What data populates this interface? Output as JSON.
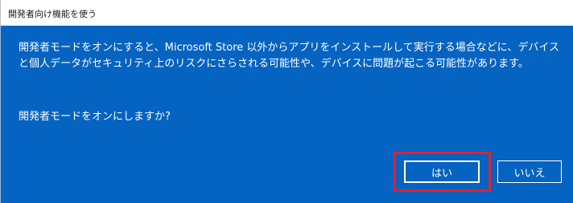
{
  "dialog": {
    "title": "開発者向け機能を使う",
    "message": "開発者モードをオンにすると、Microsoft Store 以外からアプリをインストールして実行する場合などに、デバイスと個人データがセキュリティ上のリスクにさらされる可能性や、デバイスに問題が起こる可能性があります。",
    "question": "開発者モードをオンにしますか?",
    "yes_label": "はい",
    "no_label": "いいえ"
  },
  "colors": {
    "dialog_background": "#0563c1",
    "highlight_border": "#e5202e",
    "text": "#ffffff"
  }
}
